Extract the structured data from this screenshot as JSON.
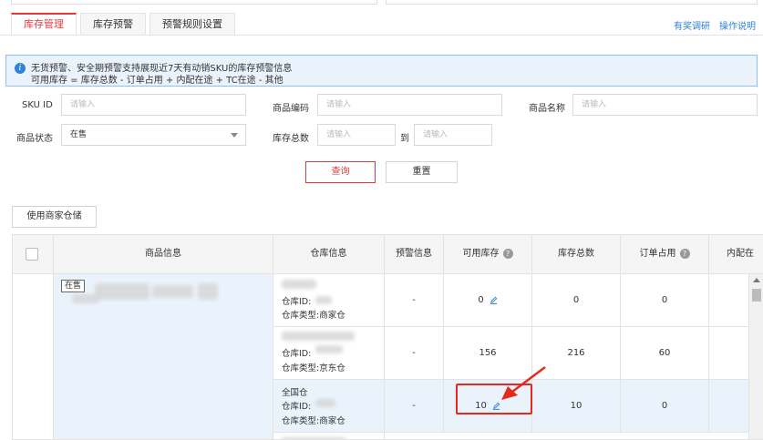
{
  "tabs": [
    {
      "label": "库存管理",
      "active": true
    },
    {
      "label": "库存预警",
      "active": false
    },
    {
      "label": "预警规则设置",
      "active": false
    }
  ],
  "top_links": {
    "survey": "有奖调研",
    "help": "操作说明"
  },
  "notice": {
    "line1": "无货预警、安全期预警支持展现近7天有动销SKU的库存预警信息",
    "line2": "可用库存 = 库存总数 - 订单占用 + 内配在途 + TC在途 - 其他"
  },
  "filters": {
    "sku_label": "SKU ID",
    "sku_placeholder": "请输入",
    "code_label": "商品编码",
    "code_placeholder": "请输入",
    "name_label": "商品名称",
    "name_placeholder": "请输入",
    "status_label": "商品状态",
    "status_value": "在售",
    "total_label": "库存总数",
    "total_from_placeholder": "请输入",
    "to_label": "到",
    "total_to_placeholder": "请输入"
  },
  "buttons": {
    "query": "查询",
    "reset": "重置",
    "use_merchant_wh": "使用商家仓储"
  },
  "table": {
    "headers": {
      "product": "商品信息",
      "warehouse": "仓库信息",
      "warning": "预警信息",
      "available": "可用库存",
      "total": "库存总数",
      "order": "订单占用",
      "internal": "内配在"
    },
    "product_status": "在售",
    "rows": [
      {
        "wh_name": "",
        "wh_id_label": "仓库ID:",
        "wh_type_label": "仓库类型:",
        "wh_type": "商家仓",
        "warning": "-",
        "available": "0",
        "total": "0",
        "order": "0"
      },
      {
        "wh_name": "",
        "wh_id_label": "仓库ID:",
        "wh_type_label": "仓库类型:",
        "wh_type": "京东仓",
        "warning": "-",
        "available": "156",
        "total": "216",
        "order": "60"
      },
      {
        "wh_name": "全国仓",
        "wh_id_label": "仓库ID:",
        "wh_type_label": "仓库类型:",
        "wh_type": "商家仓",
        "warning": "-",
        "available": "10",
        "total": "10",
        "order": "0"
      }
    ]
  },
  "colors": {
    "accent": "#e4393c",
    "link": "#2d83d4",
    "highlight": "#e8281e"
  }
}
